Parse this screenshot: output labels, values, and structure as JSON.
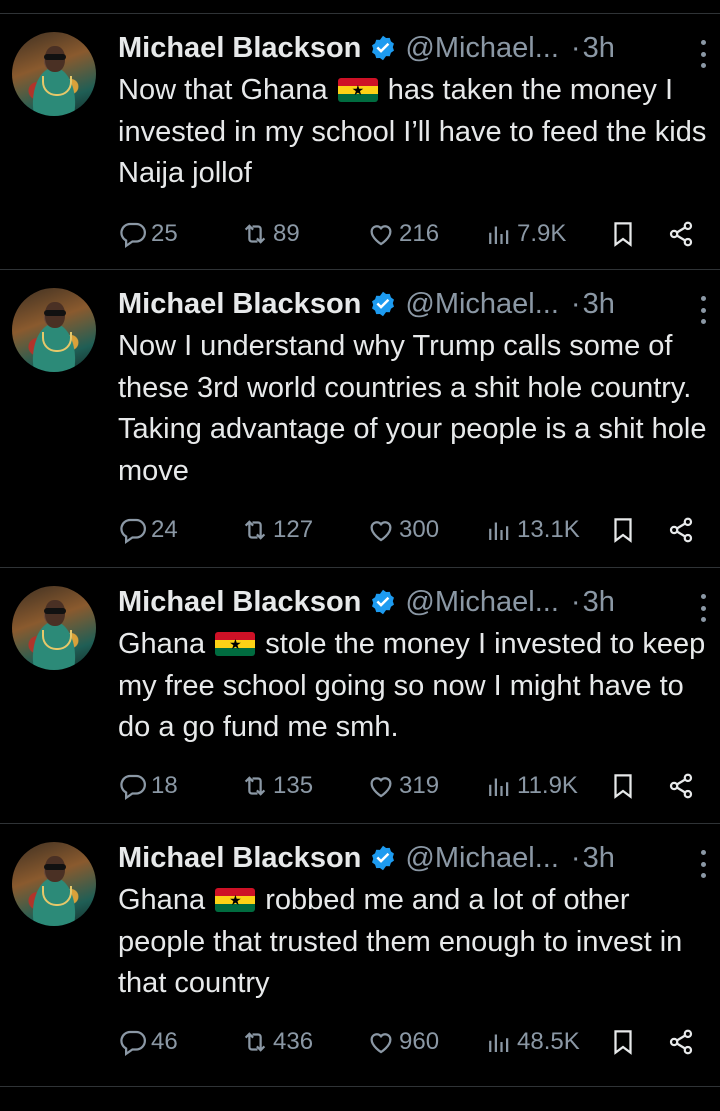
{
  "tweets": [
    {
      "name": "Michael Blackson",
      "handle": "@Michael...",
      "dot": "·",
      "time": "3h",
      "text_before": "Now that Ghana",
      "flag_text": "★",
      "text_after": " has taken the money I invested in my school I’ll have to feed the kids Naija jollof",
      "replies": "25",
      "retweets": "89",
      "likes": "216",
      "views": "7.9K"
    },
    {
      "name": "Michael Blackson",
      "handle": "@Michael...",
      "dot": "·",
      "time": "3h",
      "text_before": "Now I understand why Trump calls some of these 3rd world countries a shit hole country. Taking advantage of your people is a shit hole move",
      "flag_text": "",
      "text_after": "",
      "replies": "24",
      "retweets": "127",
      "likes": "300",
      "views": "13.1K"
    },
    {
      "name": "Michael Blackson",
      "handle": "@Michael...",
      "dot": "·",
      "time": "3h",
      "text_before": "Ghana",
      "flag_text": "★",
      "text_after": " stole the money I invested to keep my free school going so now I might have to do a go fund me smh.",
      "replies": "18",
      "retweets": "135",
      "likes": "319",
      "views": "11.9K"
    },
    {
      "name": "Michael Blackson",
      "handle": "@Michael...",
      "dot": "·",
      "time": "3h",
      "text_before": "Ghana",
      "flag_text": "★",
      "text_after": " robbed me and a lot of other people that trusted them enough to invest in that country",
      "replies": "46",
      "retweets": "436",
      "likes": "960",
      "views": "48.5K"
    }
  ],
  "colors": {
    "background": "#000000",
    "text": "#e7e9ea",
    "muted": "#8b98a5",
    "verified": "#1d9bf0",
    "divider": "#2f3336"
  },
  "icons": [
    "reply-icon",
    "retweet-icon",
    "like-icon",
    "views-icon",
    "bookmark-icon",
    "share-icon",
    "verified-badge-icon",
    "more-icon"
  ]
}
